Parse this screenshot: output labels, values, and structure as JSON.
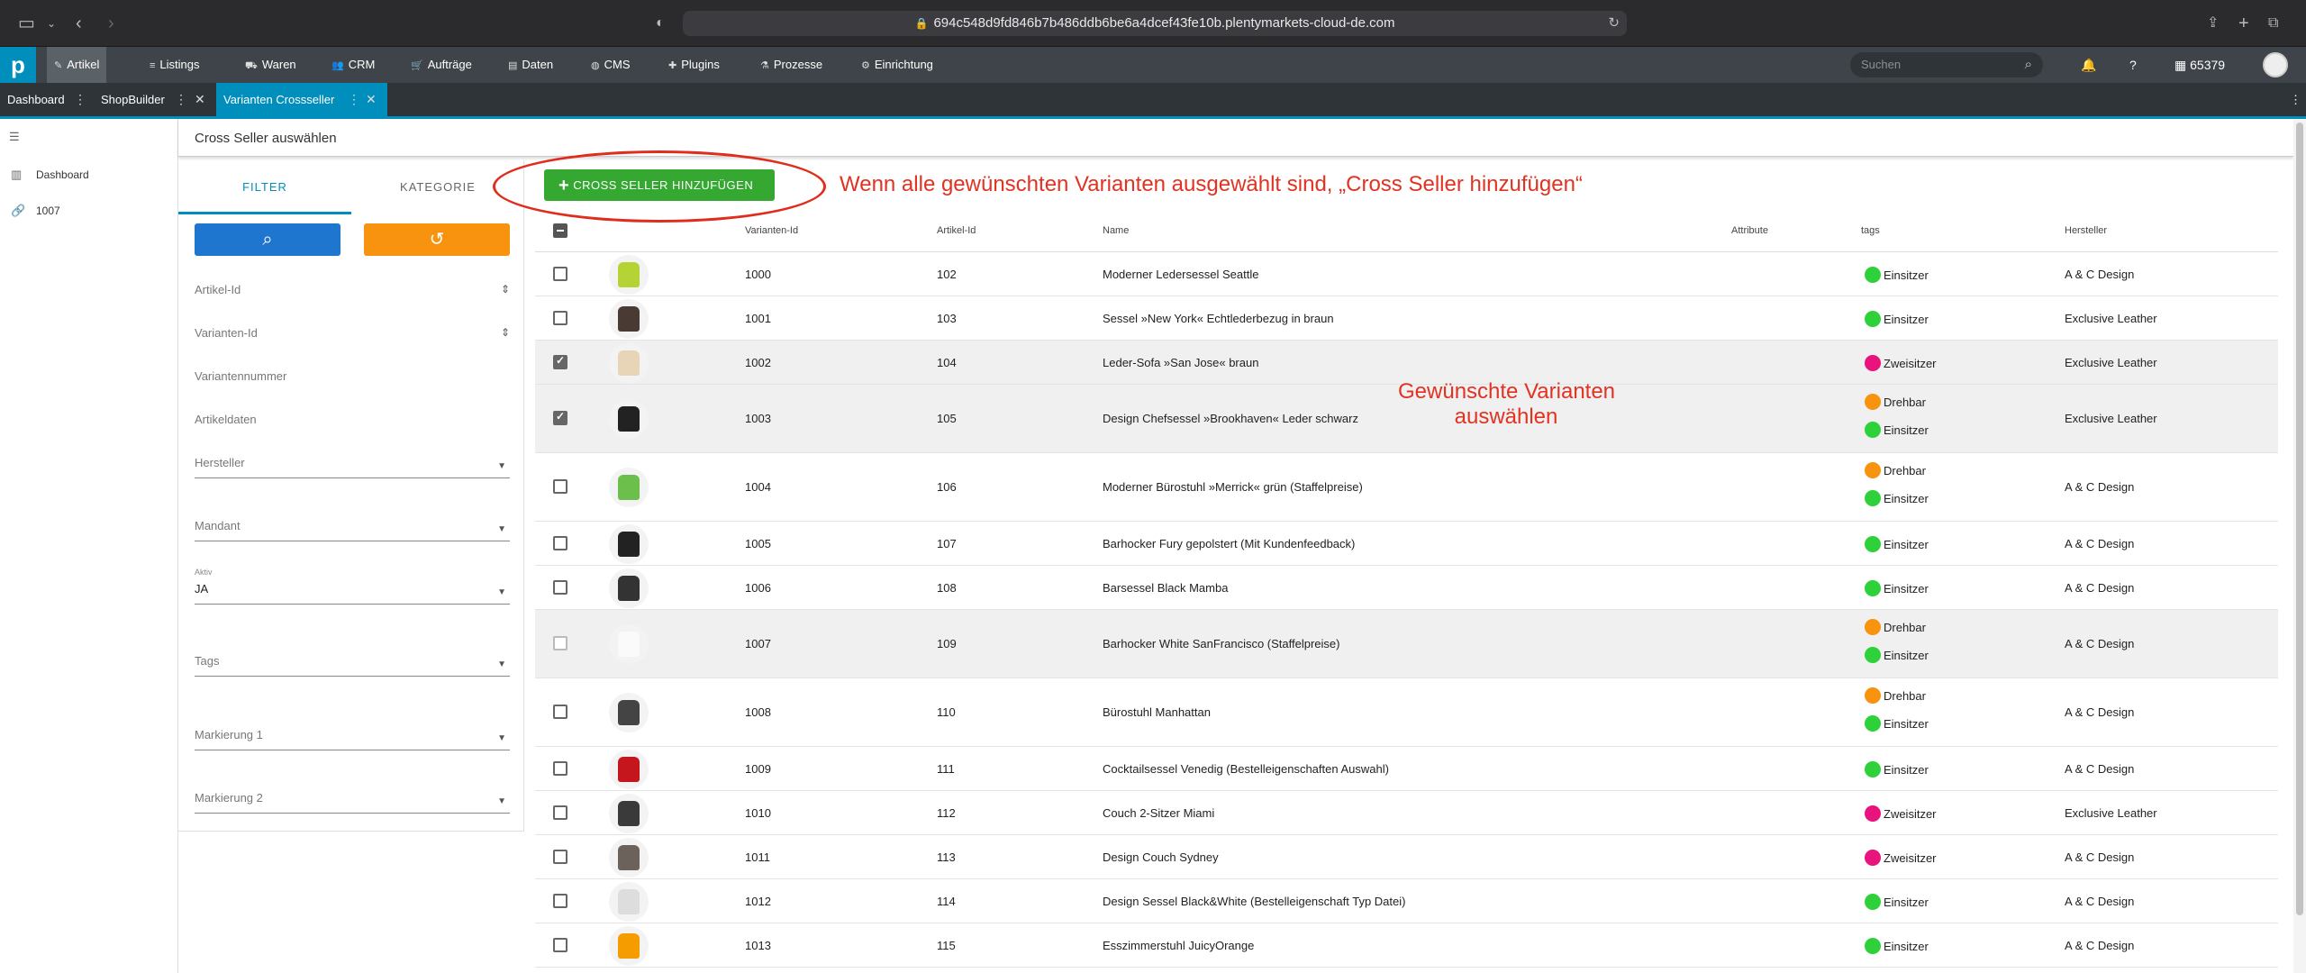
{
  "browser": {
    "url": "694c548d9fd846b7b486ddb6be6a4dcef43fe10b.plentymarkets-cloud-de.com"
  },
  "nav": {
    "items": [
      {
        "label": "Artikel",
        "icon": "tag-icon"
      },
      {
        "label": "Listings",
        "icon": "list-icon"
      },
      {
        "label": "Waren",
        "icon": "truck-icon"
      },
      {
        "label": "CRM",
        "icon": "people-icon"
      },
      {
        "label": "Aufträge",
        "icon": "cart-icon"
      },
      {
        "label": "Daten",
        "icon": "database-icon"
      },
      {
        "label": "CMS",
        "icon": "globe-icon"
      },
      {
        "label": "Plugins",
        "icon": "puzzle-icon"
      },
      {
        "label": "Prozesse",
        "icon": "process-icon"
      },
      {
        "label": "Einrichtung",
        "icon": "gear-icon"
      }
    ],
    "search_placeholder": "Suchen",
    "user_id": "65379"
  },
  "tabs": [
    {
      "label": "Dashboard"
    },
    {
      "label": "ShopBuilder"
    },
    {
      "label": "Varianten Crossseller"
    }
  ],
  "sidebar": {
    "items": [
      {
        "label": "Dashboard"
      },
      {
        "label": "1007"
      }
    ]
  },
  "page_title": "Cross Seller auswählen",
  "filter": {
    "tab_filter": "FILTER",
    "tab_kategorie": "KATEGORIE",
    "fields": {
      "artikel_id": "Artikel-Id",
      "varianten_id": "Varianten-Id",
      "variantennummer": "Variantennummer",
      "artikeldaten": "Artikeldaten",
      "hersteller": "Hersteller",
      "mandant": "Mandant",
      "aktiv_label": "Aktiv",
      "aktiv_value": "JA",
      "tags": "Tags",
      "markierung1": "Markierung 1",
      "markierung2": "Markierung 2"
    }
  },
  "table": {
    "add_button": "CROSS SELLER HINZUFÜGEN",
    "headers": {
      "varianten_id": "Varianten-Id",
      "artikel_id": "Artikel-Id",
      "name": "Name",
      "attribute": "Attribute",
      "tags": "tags",
      "hersteller": "Hersteller"
    },
    "rows": [
      {
        "vid": "1000",
        "aid": "102",
        "name": "Moderner Ledersessel Seattle",
        "tags": [
          "Einsitzer"
        ],
        "hersteller": "A & C Design",
        "checked": false
      },
      {
        "vid": "1001",
        "aid": "103",
        "name": "Sessel »New York« Echtlederbezug in braun",
        "tags": [
          "Einsitzer"
        ],
        "hersteller": "Exclusive Leather",
        "checked": false
      },
      {
        "vid": "1002",
        "aid": "104",
        "name": "Leder-Sofa »San Jose« braun",
        "tags": [
          "Zweisitzer"
        ],
        "hersteller": "Exclusive Leather",
        "checked": true
      },
      {
        "vid": "1003",
        "aid": "105",
        "name": "Design Chefsessel »Brookhaven« Leder schwarz",
        "tags": [
          "Drehbar",
          "Einsitzer"
        ],
        "hersteller": "Exclusive Leather",
        "checked": true
      },
      {
        "vid": "1004",
        "aid": "106",
        "name": "Moderner Bürostuhl »Merrick« grün (Staffelpreise)",
        "tags": [
          "Drehbar",
          "Einsitzer"
        ],
        "hersteller": "A & C Design",
        "checked": false
      },
      {
        "vid": "1005",
        "aid": "107",
        "name": "Barhocker Fury gepolstert (Mit Kundenfeedback)",
        "tags": [
          "Einsitzer"
        ],
        "hersteller": "A & C Design",
        "checked": false
      },
      {
        "vid": "1006",
        "aid": "108",
        "name": "Barsessel Black Mamba",
        "tags": [
          "Einsitzer"
        ],
        "hersteller": "A & C Design",
        "checked": false
      },
      {
        "vid": "1007",
        "aid": "109",
        "name": "Barhocker White SanFrancisco (Staffelpreise)",
        "tags": [
          "Drehbar",
          "Einsitzer"
        ],
        "hersteller": "A & C Design",
        "checked": false
      },
      {
        "vid": "1008",
        "aid": "110",
        "name": "Bürostuhl Manhattan",
        "tags": [
          "Drehbar",
          "Einsitzer"
        ],
        "hersteller": "A & C Design",
        "checked": false
      },
      {
        "vid": "1009",
        "aid": "111",
        "name": "Cocktailsessel Venedig (Bestelleigenschaften Auswahl)",
        "tags": [
          "Einsitzer"
        ],
        "hersteller": "A & C Design",
        "checked": false
      },
      {
        "vid": "1010",
        "aid": "112",
        "name": "Couch 2-Sitzer Miami",
        "tags": [
          "Zweisitzer"
        ],
        "hersteller": "Exclusive Leather",
        "checked": false
      },
      {
        "vid": "1011",
        "aid": "113",
        "name": "Design Couch Sydney",
        "tags": [
          "Zweisitzer"
        ],
        "hersteller": "A & C Design",
        "checked": false
      },
      {
        "vid": "1012",
        "aid": "114",
        "name": "Design Sessel Black&White (Bestelleigenschaft Typ Datei)",
        "tags": [
          "Einsitzer"
        ],
        "hersteller": "A & C Design",
        "checked": false
      },
      {
        "vid": "1013",
        "aid": "115",
        "name": "Esszimmerstuhl JuicyOrange",
        "tags": [
          "Einsitzer"
        ],
        "hersteller": "A & C Design",
        "checked": false
      }
    ]
  },
  "tag_colors": {
    "Einsitzer": "#2fd13a",
    "Zweisitzer": "#e8137d",
    "Drehbar": "#f7930e"
  },
  "annotations": {
    "top": "Wenn alle gewünschten Varianten ausgewählt sind, „Cross Seller hinzufügen“",
    "middle_line1": "Gewünschte Varianten",
    "middle_line2": "auswählen"
  },
  "colors": {
    "accent": "#008ebd",
    "add_button": "#35a832",
    "reset_button": "#f7930e",
    "annotation": "#e23222"
  }
}
